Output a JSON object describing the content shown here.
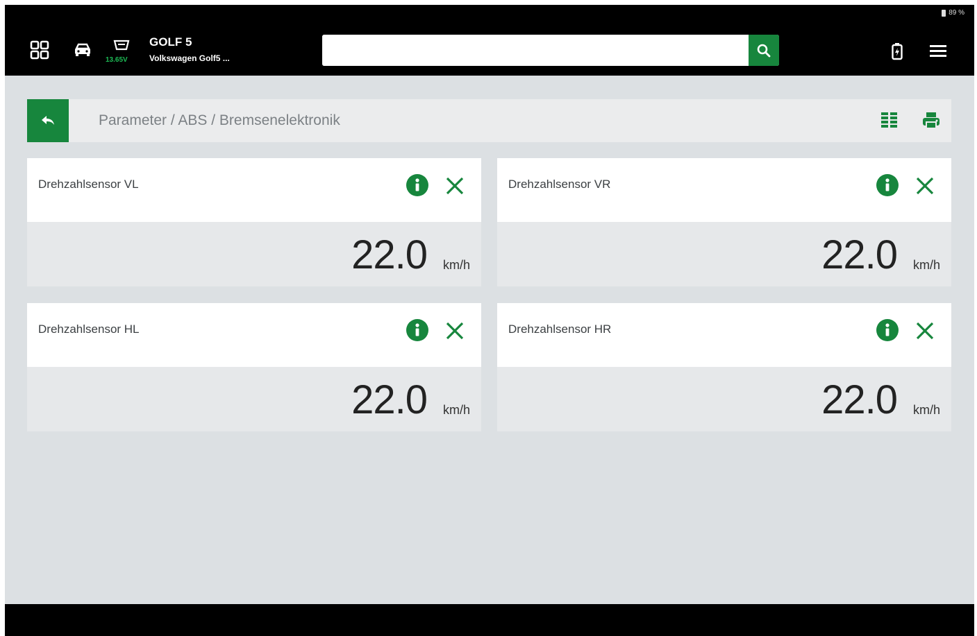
{
  "status": {
    "battery_text": "89 %"
  },
  "header": {
    "vehicle_name": "GOLF 5",
    "vehicle_model": "Volkswagen Golf5 ...",
    "voltage": "13.65V",
    "search_placeholder": ""
  },
  "breadcrumb": {
    "path": "Parameter / ABS / Bremsenelektronik"
  },
  "cards": [
    {
      "title": "Drehzahlsensor VL",
      "value": "22.0",
      "unit": "km/h"
    },
    {
      "title": "Drehzahlsensor VR",
      "value": "22.0",
      "unit": "km/h"
    },
    {
      "title": "Drehzahlsensor HL",
      "value": "22.0",
      "unit": "km/h"
    },
    {
      "title": "Drehzahlsensor HR",
      "value": "22.0",
      "unit": "km/h"
    }
  ],
  "colors": {
    "accent": "#17863d",
    "voltage": "#1dbb55",
    "background": "#dce0e3"
  },
  "icons": [
    "apps-grid-icon",
    "car-icon",
    "obd-connector-icon",
    "search-icon",
    "battery-icon",
    "menu-icon",
    "back-arrow-icon",
    "columns-icon",
    "print-icon",
    "info-icon",
    "close-icon"
  ]
}
